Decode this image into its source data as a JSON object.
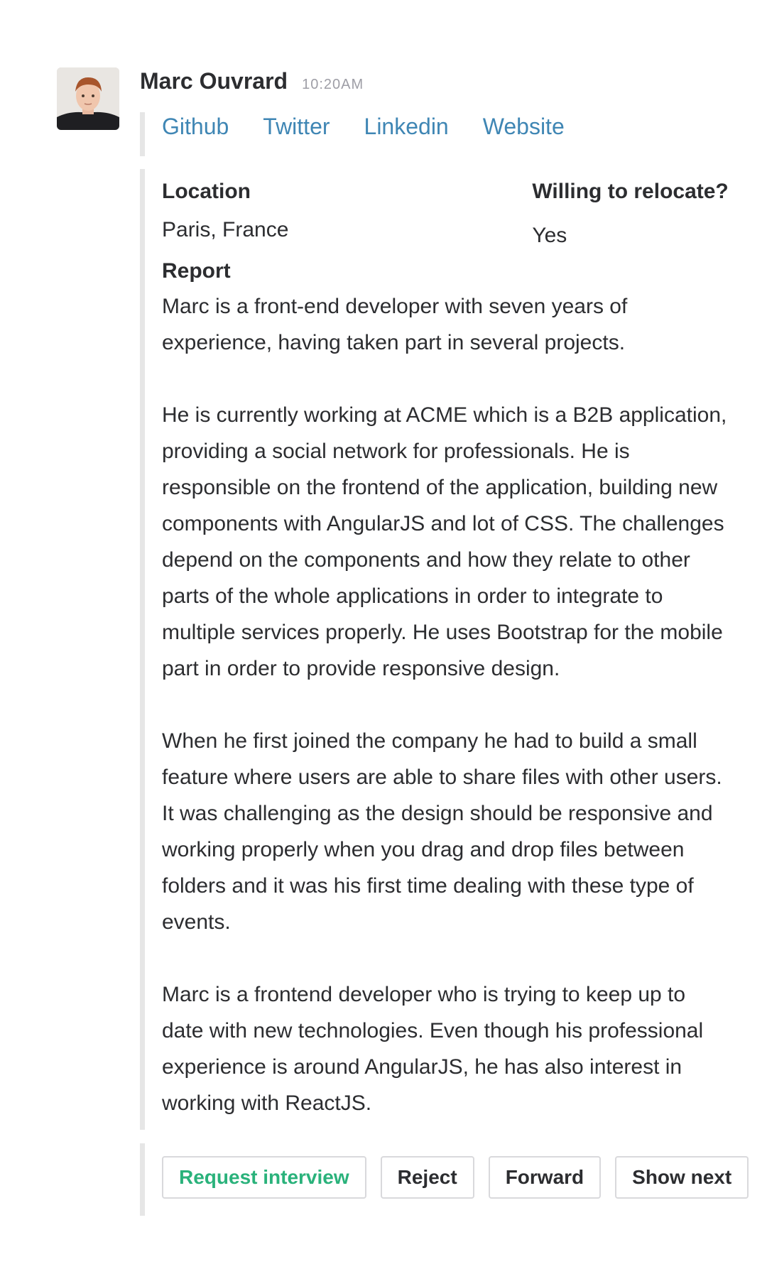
{
  "message": {
    "sender_name": "Marc Ouvrard",
    "timestamp": "10:20AM",
    "links": [
      {
        "label": "Github"
      },
      {
        "label": "Twitter"
      },
      {
        "label": "Linkedin"
      },
      {
        "label": "Website"
      }
    ],
    "fields": {
      "location_title": "Location",
      "location_value": "Paris, France",
      "relocate_title": "Willing to relocate?",
      "relocate_value": "Yes"
    },
    "report": {
      "title": "Report",
      "paragraphs": [
        "Marc is a front-end developer with seven years of experience, having taken part in several projects.",
        "He is currently working at ACME which is a B2B application, providing a  social network for professionals. He is responsible on the frontend of the application, building new components with AngularJS and lot of CSS. The challenges depend on the components and how they relate to other parts of the whole applications in order to integrate to multiple services properly. He uses Bootstrap for the mobile part in order to provide responsive design.",
        "When he first joined the company he had to build a small feature where users are able to share files with other users. It was challenging as the design should be responsive and working properly when you drag and drop files between folders and it was his first time dealing with these type of events.",
        "Marc is a frontend developer who is trying to keep up to date with new technologies. Even though his professional experience is around AngularJS, he has also interest in working with ReactJS."
      ]
    },
    "actions": {
      "request_interview": "Request interview",
      "reject": "Reject",
      "forward": "Forward",
      "show_next": "Show next"
    }
  },
  "colors": {
    "link": "#3f86b4",
    "primary_action": "#2ab27b",
    "timestamp": "#9e9ea6",
    "quote_bar": "#e6e6e6"
  }
}
